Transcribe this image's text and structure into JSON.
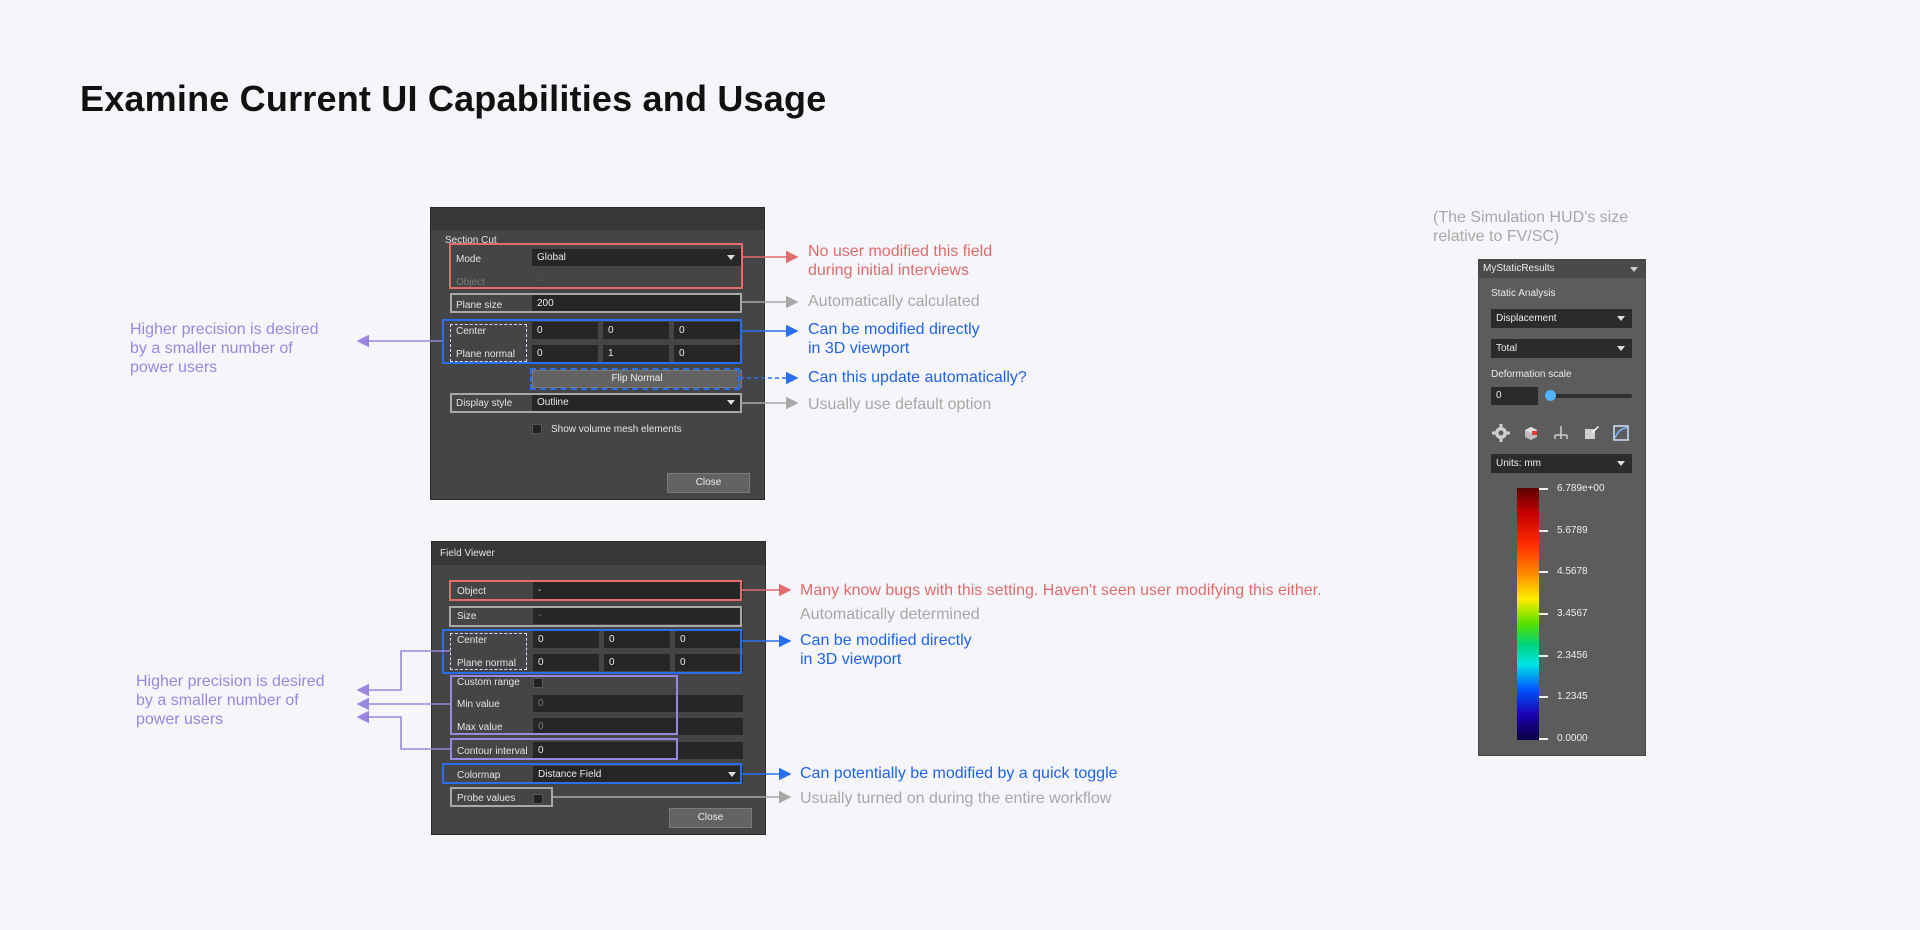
{
  "page_title": "Examine Current UI Capabilities and Usage",
  "section_cut": {
    "title": "Section Cut",
    "mode_label": "Mode",
    "mode_value": "Global",
    "object_label": "Object",
    "object_value": "-",
    "plane_size_label": "Plane size",
    "plane_size_value": "200",
    "center_label": "Center",
    "center": [
      "0",
      "0",
      "0"
    ],
    "plane_normal_label": "Plane normal",
    "plane_normal": [
      "0",
      "1",
      "0"
    ],
    "flip_normal": "Flip Normal",
    "display_style_label": "Display style",
    "display_style_value": "Outline",
    "show_volume_label": "Show volume mesh elements",
    "close": "Close"
  },
  "field_viewer": {
    "title": "Field Viewer",
    "object_label": "Object",
    "object_value": "-",
    "size_label": "Size",
    "size_value": "-",
    "center_label": "Center",
    "center": [
      "0",
      "0",
      "0"
    ],
    "plane_normal_label": "Plane normal",
    "plane_normal": [
      "0",
      "0",
      "0"
    ],
    "custom_range_label": "Custom range",
    "min_label": "Min value",
    "min_value": "0",
    "max_label": "Max value",
    "max_value": "0",
    "contour_label": "Contour interval",
    "contour_value": "0",
    "colormap_label": "Colormap",
    "colormap_value": "Distance Field",
    "probe_label": "Probe values",
    "close": "Close"
  },
  "annotations": {
    "sc_mode": [
      "No user modified this field",
      "during initial interviews"
    ],
    "sc_size": "Automatically calculated",
    "sc_center": [
      "Can be modified directly",
      "in 3D viewport"
    ],
    "sc_flip": "Can this update automatically?",
    "sc_display": "Usually use default option",
    "sc_precision": [
      "Higher precision is desired",
      "by a smaller number of",
      "power users"
    ],
    "fv_object": "Many know bugs with this setting. Haven't seen user modifying this either.",
    "fv_size": "Automatically determined",
    "fv_center": [
      "Can be modified directly",
      "in 3D viewport"
    ],
    "fv_precision": [
      "Higher precision is desired",
      "by a smaller number of",
      "power users"
    ],
    "fv_colormap": "Can potentially be modified by a quick toggle",
    "fv_probe": "Usually turned on during the entire workflow",
    "hud_note": [
      "(The Simulation HUD's size",
      "relative to FV/SC)"
    ]
  },
  "hud": {
    "title": "MyStaticResults",
    "section": "Static Analysis",
    "result_type": "Displacement",
    "component": "Total",
    "deformation_label": "Deformation scale",
    "deformation_value": "0",
    "deformation_slider_fraction": 0.0,
    "tool_icons": [
      "gear-icon",
      "cube-icon",
      "tree-icon",
      "edit-icon",
      "chart-icon"
    ],
    "units": "Units: mm",
    "legend_ticks": [
      "6.789e+00",
      "5.6789",
      "4.5678",
      "3.4567",
      "2.3456",
      "1.2345",
      "0.0000"
    ]
  },
  "colors": {
    "red": "#e06c6c",
    "gray": "#a8a8a8",
    "blue": "#2a6ef0",
    "purple": "#9a88e0"
  }
}
